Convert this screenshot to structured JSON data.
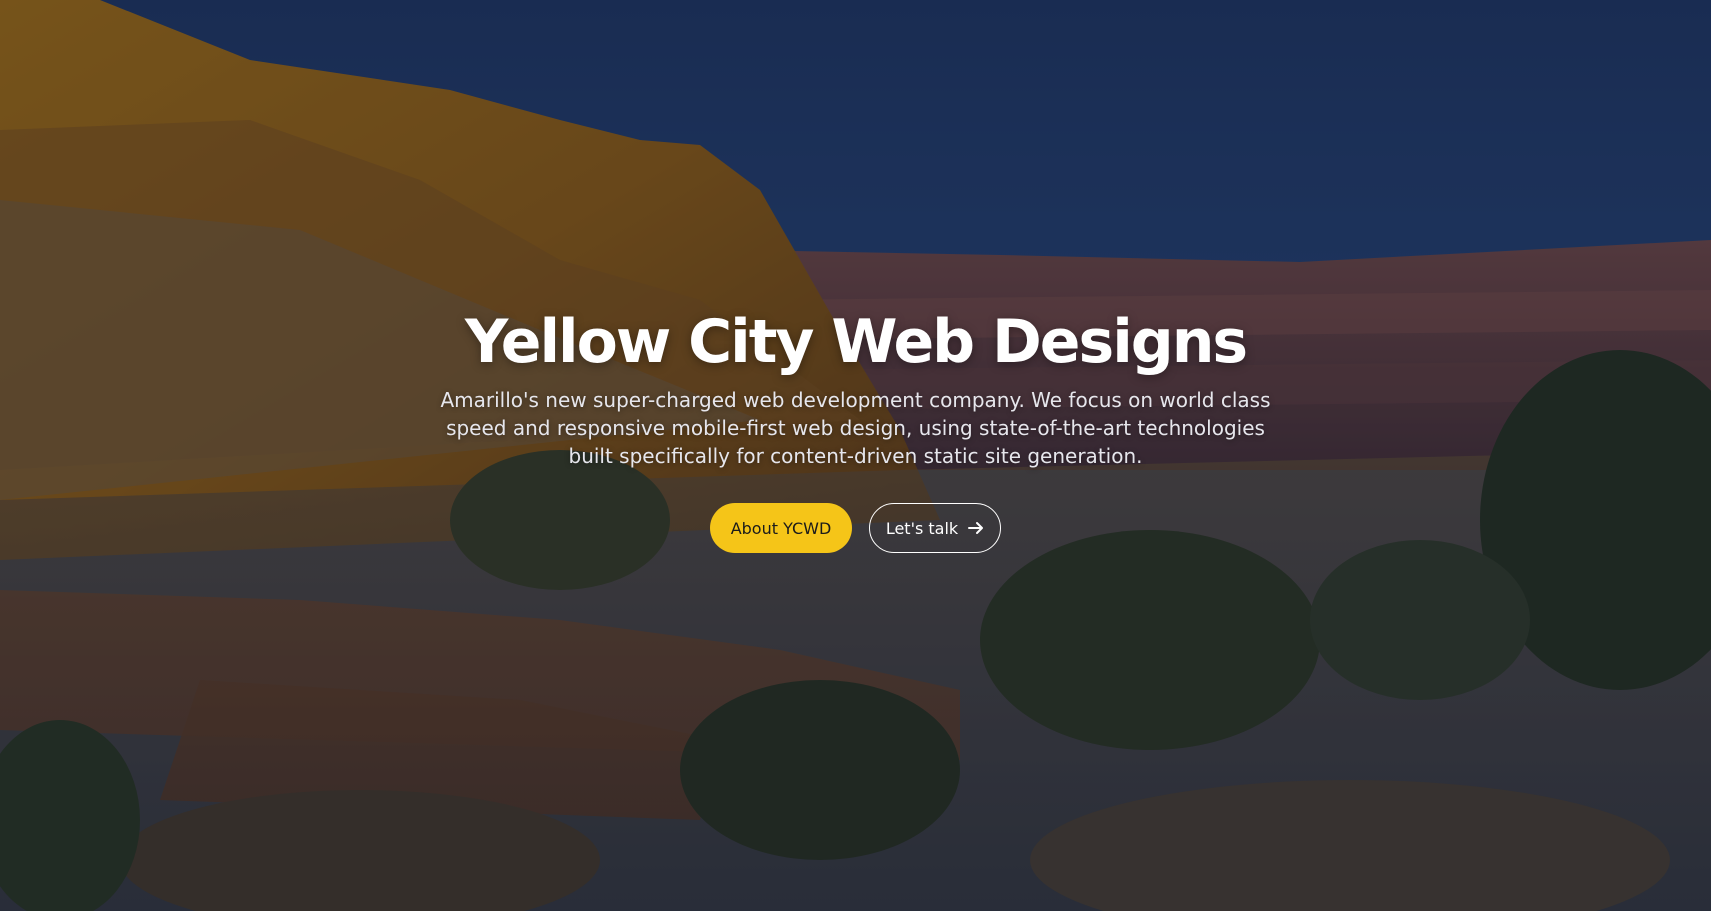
{
  "hero": {
    "title": "Yellow City Web Designs",
    "subtitle": "Amarillo's new super-charged web development company. We focus on world class speed and responsive mobile-first web design, using state-of-the-art technologies built specifically for content-driven static site generation.",
    "background": "canyon-landscape-photo",
    "primary_button": "About YCWD",
    "secondary_button": "Let's talk",
    "secondary_button_icon": "arrow-right-icon"
  },
  "colors": {
    "accent": "#f5c518",
    "title": "#ffffff",
    "sky": "#2b4f88"
  }
}
